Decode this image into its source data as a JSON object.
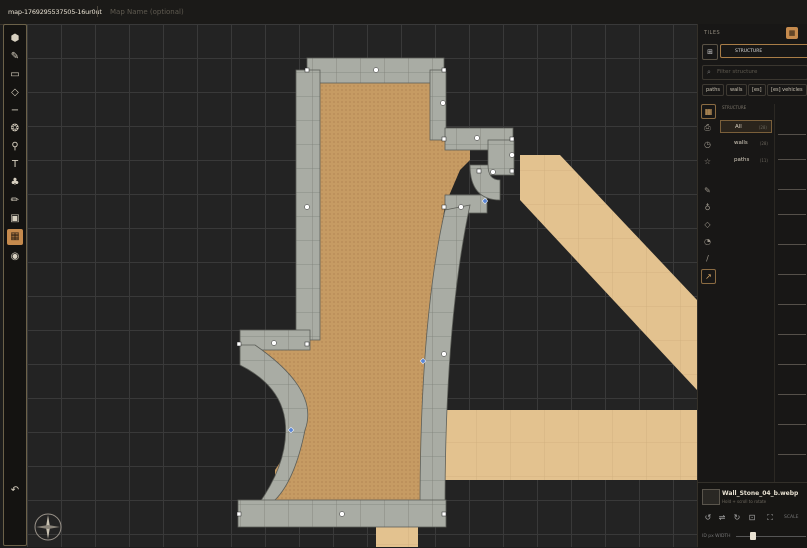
{
  "topbar": {
    "map_id": "map-1769295537505-16ur0ut",
    "map_name_placeholder": "Map Name (optional)"
  },
  "toolbar": {
    "tools": [
      "select-icon",
      "brush-icon",
      "rectangle-icon",
      "eraser-icon",
      "line-icon",
      "stamp-icon",
      "pin-icon",
      "text-icon",
      "tree-icon",
      "pencil-icon",
      "image-icon",
      "grid-icon",
      "palette-icon",
      "undo-icon"
    ],
    "active_tool": "grid-icon"
  },
  "right_panel": {
    "title": "TILES",
    "tab_structure": "STRUCTURE",
    "search_placeholder": "Filter structure",
    "chips": [
      "paths",
      "walls",
      "[es]",
      "[es] vehicles"
    ],
    "tree_header": "STRUCTURE",
    "tree_items": [
      {
        "label": "All",
        "count": "(28)"
      },
      {
        "label": "walls",
        "count": "(28)"
      },
      {
        "label": "paths",
        "count": "(11)"
      }
    ],
    "selected_asset": "Wall_Stone_04_b.webp",
    "selected_asset_sub": "Hold + scroll to rotate",
    "scale_label": "SCALE",
    "width_label": "ID px  WIDTH"
  },
  "colors": {
    "accent": "#c58a4d",
    "floor": "#c59a62",
    "path": "#e2c08d",
    "wall": "#a8aba3"
  }
}
